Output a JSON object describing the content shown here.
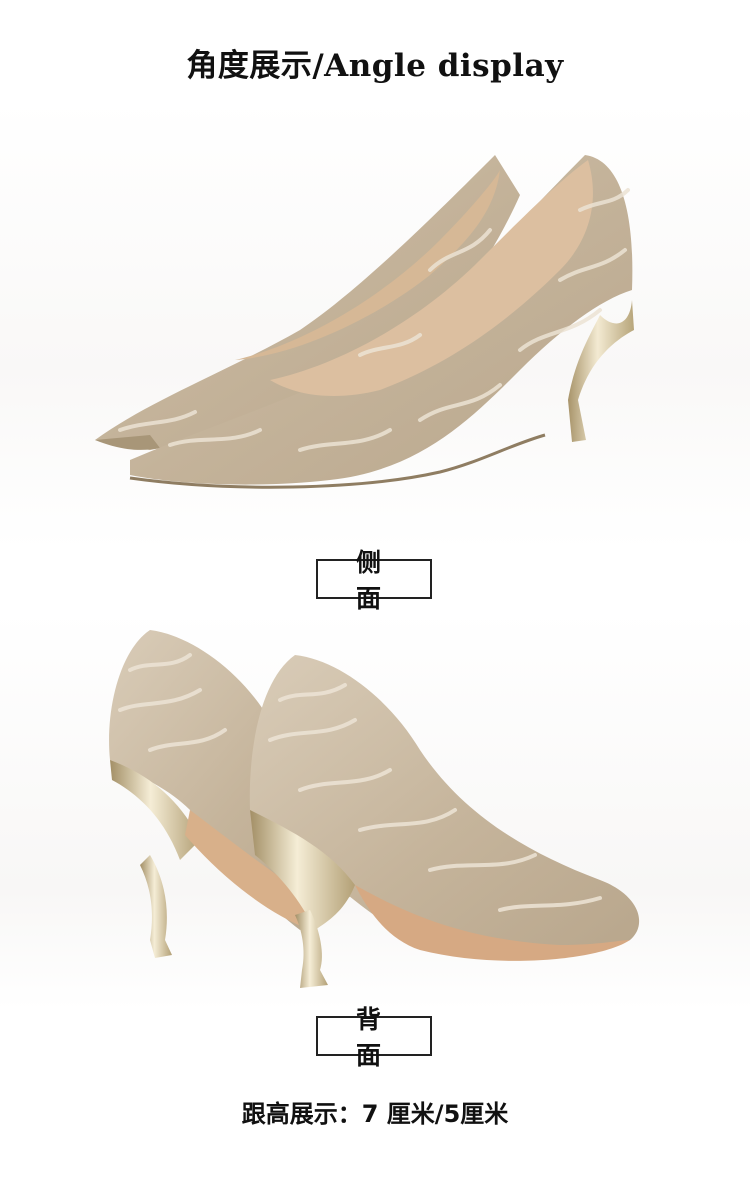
{
  "title": "角度展示/Angle display",
  "views": {
    "side": {
      "label": "侧面"
    },
    "back": {
      "label": "背面"
    }
  },
  "heel_height": {
    "prefix": "跟高展示：",
    "option_a": "7 厘米",
    "separator": "/",
    "option_b": "5厘米"
  },
  "colors": {
    "shoe_base": "#c8b8a0",
    "shoe_highlight": "#e6dccd",
    "insole": "#dcbfa0",
    "heel_metal": "#d4c49a"
  }
}
